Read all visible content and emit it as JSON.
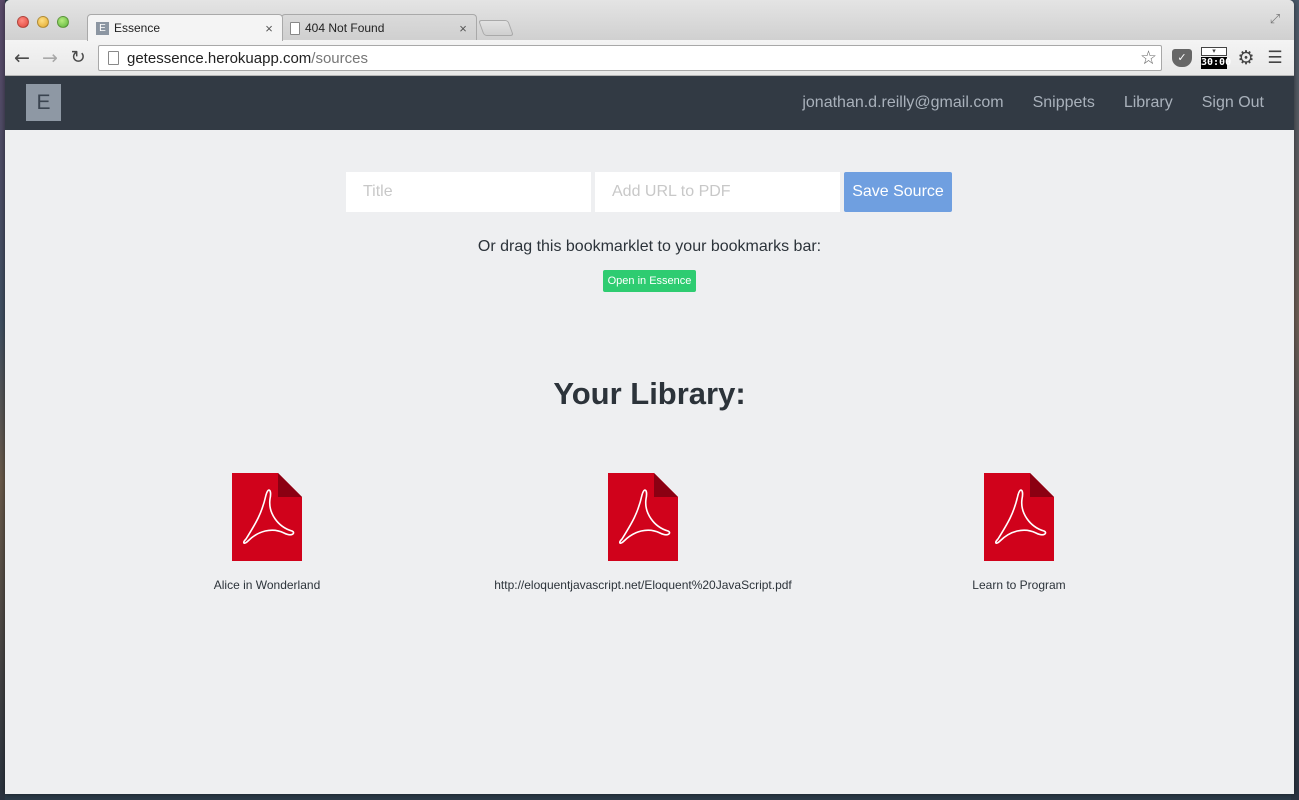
{
  "browser": {
    "tabs": [
      {
        "title": "Essence",
        "favicon": "E",
        "active": true
      },
      {
        "title": "404 Not Found",
        "active": false
      }
    ],
    "tab_close_glyph": "×",
    "url_host": "getessence.herokuapp.com",
    "url_path": "/sources",
    "extensions": {
      "timer_label": "30:00"
    }
  },
  "navbar": {
    "brand": "E",
    "links": [
      "jonathan.d.reilly@gmail.com",
      "Snippets",
      "Library",
      "Sign Out"
    ]
  },
  "form": {
    "title_placeholder": "Title",
    "url_placeholder": "Add URL to PDF",
    "save_label": "Save Source"
  },
  "bookmarklet": {
    "instruction": "Or drag this bookmarklet to your bookmarks bar:",
    "button_label": "Open in Essence"
  },
  "library": {
    "heading": "Your Library:",
    "items": [
      {
        "label": "Alice in Wonderland"
      },
      {
        "label": "http://eloquentjavascript.net/Eloquent%20JavaScript.pdf"
      },
      {
        "label": "Learn to Program"
      }
    ]
  },
  "colors": {
    "navbar": "#323a44",
    "accent_button": "#6f9fe0",
    "bookmarklet": "#2ecc71",
    "pdf_red": "#d0021b",
    "pdf_fold": "#8b0012"
  }
}
